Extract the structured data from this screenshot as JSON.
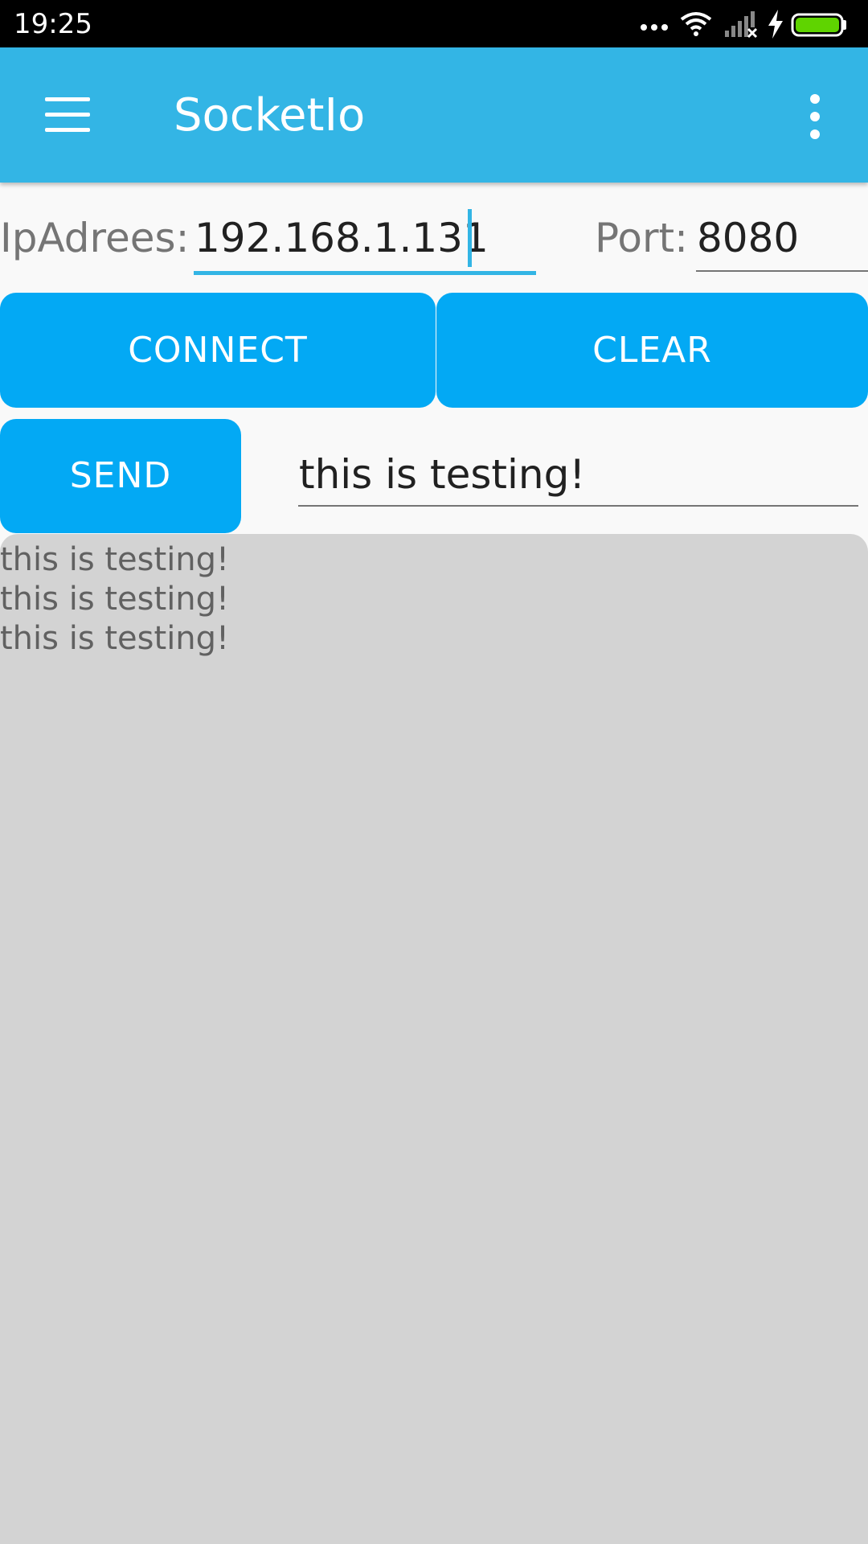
{
  "status_bar": {
    "time": "19:25",
    "icons": [
      "more-dots-icon",
      "wifi-icon",
      "signal-no-service-icon",
      "charging-bolt-icon",
      "battery-full-icon"
    ],
    "battery_color": "#5fd400"
  },
  "app_bar": {
    "title": "SocketIo",
    "color": "#33b5e5"
  },
  "connection": {
    "ip_label": "IpAdrees:",
    "ip_value": "192.168.1.131",
    "port_label": "Port:",
    "port_value": "8080"
  },
  "buttons": {
    "connect": "CONNECT",
    "clear": "CLEAR",
    "send": "SEND",
    "color": "#03a9f4"
  },
  "message_input": {
    "value": "this is testing!"
  },
  "log": {
    "background": "#d3d3d3",
    "lines": [
      "this is testing!",
      "this is testing!",
      "this is testing!"
    ]
  },
  "accent_color": "#33b5e5"
}
